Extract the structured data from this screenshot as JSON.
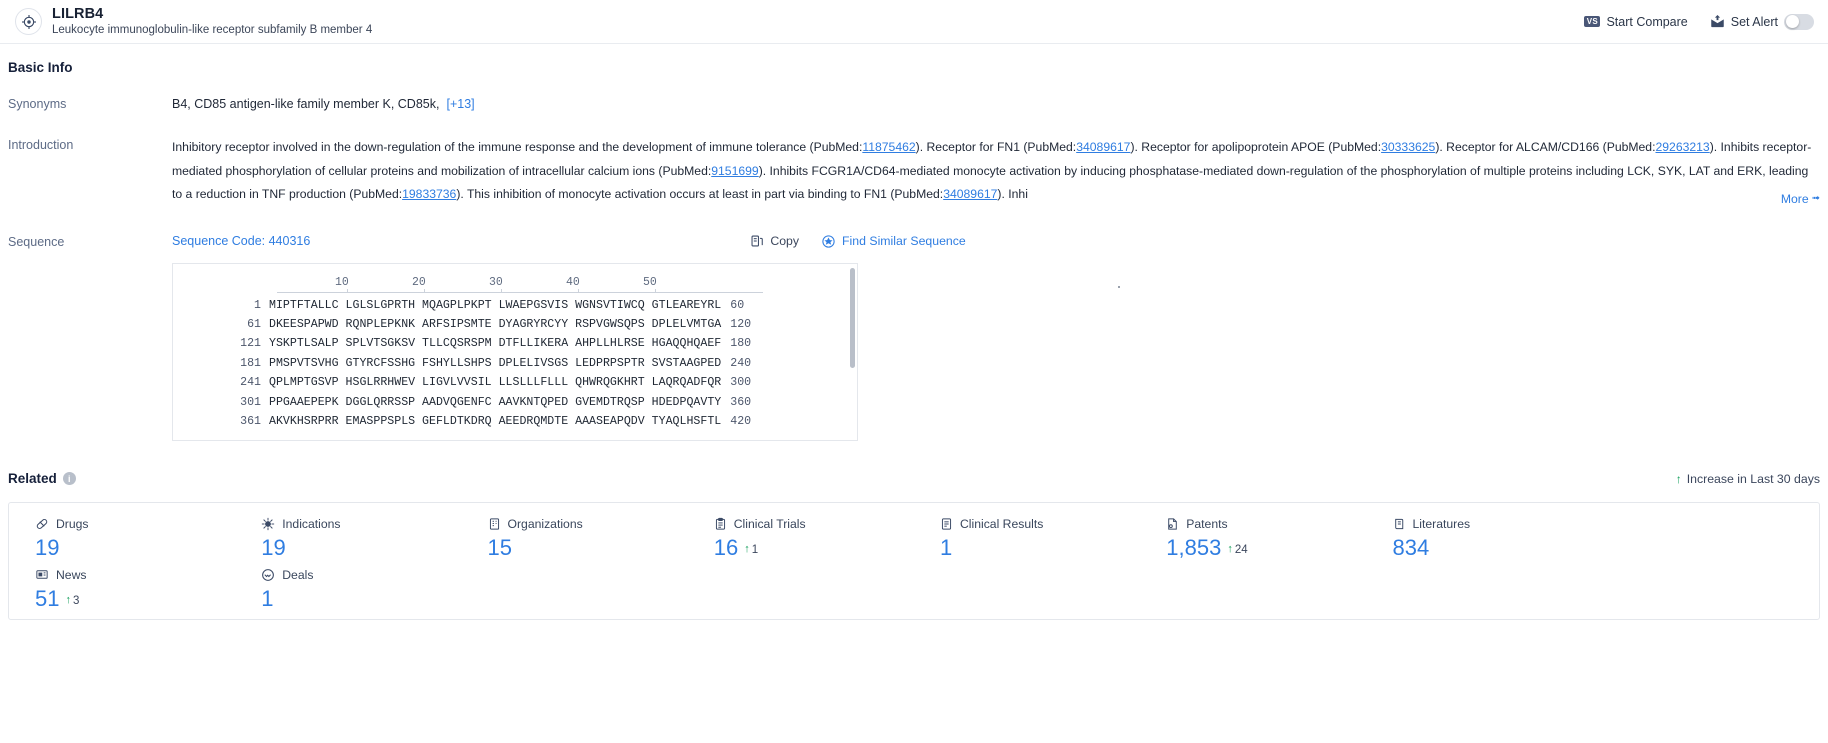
{
  "header": {
    "gene_symbol": "LILRB4",
    "gene_name": "Leukocyte immunoglobulin-like receptor subfamily B member 4",
    "brand_icon": "target-crosshair-icon",
    "compare_badge": "VS",
    "compare_label": "Start Compare",
    "alert_icon": "envelope-up-icon",
    "alert_label": "Set Alert",
    "alert_enabled": false
  },
  "basic_info": {
    "section_title": "Basic Info",
    "synonyms": {
      "label": "Synonyms",
      "value": "B4,  CD85 antigen-like family member K,  CD85k,",
      "more_count": "[+13]"
    },
    "introduction": {
      "label": "Introduction",
      "more_label": "More",
      "more_chevron": "chevron-double-down-icon",
      "parts": [
        {
          "t": "Inhibitory receptor involved in the down-regulation of the immune response and the development of immune tolerance (PubMed:"
        },
        {
          "t": "11875462",
          "link": true
        },
        {
          "t": "). Receptor for FN1 (PubMed:"
        },
        {
          "t": "34089617",
          "link": true
        },
        {
          "t": "). Receptor for apolipoprotein APOE (PubMed:"
        },
        {
          "t": "30333625",
          "link": true
        },
        {
          "t": "). Receptor for ALCAM/CD166 (PubMed:"
        },
        {
          "t": "29263213",
          "link": true
        },
        {
          "t": "). Inhibits receptor-mediated phosphorylation of cellular proteins and mobilization of intracellular calcium ions (PubMed:"
        },
        {
          "t": "9151699",
          "link": true
        },
        {
          "t": "). Inhibits FCGR1A/CD64-mediated monocyte activation by inducing phosphatase-mediated down-regulation of the phosphorylation of multiple proteins including LCK, SYK, LAT and ERK, leading to a reduction in TNF production (PubMed:"
        },
        {
          "t": "19833736",
          "link": true
        },
        {
          "t": "). This inhibition of monocyte activation occurs at least in part via binding to FN1 (PubMed:"
        },
        {
          "t": "34089617",
          "link": true
        },
        {
          "t": "). Inhi"
        }
      ]
    },
    "sequence": {
      "label": "Sequence",
      "code_label": "Sequence Code: 440316",
      "copy_icon": "copy-icon",
      "copy_label": "Copy",
      "find_icon": "find-similar-icon",
      "find_label": "Find Similar Sequence",
      "ruler_ticks": [
        "10",
        "20",
        "30",
        "40",
        "50"
      ],
      "rows": [
        {
          "start": "1",
          "blocks": "MIPTFTALLC LGLSLGPRTH MQAGPLPKPT LWAEPGSVIS WGNSVTIWCQ GTLEAREYRL",
          "end": "60"
        },
        {
          "start": "61",
          "blocks": "DKEESPAPWD RQNPLEPKNK ARFSIPSMTE DYAGRYRCYY RSPVGWSQPS DPLELVMTGA",
          "end": "120"
        },
        {
          "start": "121",
          "blocks": "YSKPTLSALP SPLVTSGKSV TLLCQSRSPM DTFLLIKERA AHPLLHLRSE HGAQQHQAEF",
          "end": "180"
        },
        {
          "start": "181",
          "blocks": "PMSPVTSVHG GTYRCFSSHG FSHYLLSHPS DPLELIVSGS LEDPRPSPTR SVSTAAGPED",
          "end": "240"
        },
        {
          "start": "241",
          "blocks": "QPLMPTGSVP HSGLRRHWEV LIGVLVVSIL LLSLLLFLLL QHWRQGKHRT LAQRQADFQR",
          "end": "300"
        },
        {
          "start": "301",
          "blocks": "PPGAAEPEPK DGGLQRRSSP AADVQGENFC AAVKNTQPED GVEMDTRQSP HDEDPQAVTY",
          "end": "360"
        },
        {
          "start": "361",
          "blocks": "AKVKHSRPRR EMASPPSPLS GEFLDTKDRQ AEEDRQMDTE AAASEAPQDV TYAQLHSFTL",
          "end": "420"
        }
      ]
    }
  },
  "related": {
    "title": "Related",
    "info_icon": "info-icon",
    "legend_arrow": "arrow-up-icon",
    "legend_text": "Increase in Last 30 days",
    "metrics": [
      {
        "label": "Drugs",
        "icon": "pill-icon",
        "value": "19",
        "delta": ""
      },
      {
        "label": "Indications",
        "icon": "virus-icon",
        "value": "19",
        "delta": ""
      },
      {
        "label": "Organizations",
        "icon": "building-icon",
        "value": "15",
        "delta": ""
      },
      {
        "label": "Clinical Trials",
        "icon": "clipboard-icon",
        "value": "16",
        "delta": "1"
      },
      {
        "label": "Clinical Results",
        "icon": "results-icon",
        "value": "1",
        "delta": ""
      },
      {
        "label": "Patents",
        "icon": "patent-icon",
        "value": "1,853",
        "delta": "24"
      },
      {
        "label": "Literatures",
        "icon": "book-icon",
        "value": "834",
        "delta": ""
      },
      {
        "label": "",
        "icon": "",
        "value": "",
        "delta": ""
      },
      {
        "label": "News",
        "icon": "news-icon",
        "value": "51",
        "delta": "3"
      },
      {
        "label": "Deals",
        "icon": "handshake-icon",
        "value": "1",
        "delta": ""
      }
    ]
  }
}
